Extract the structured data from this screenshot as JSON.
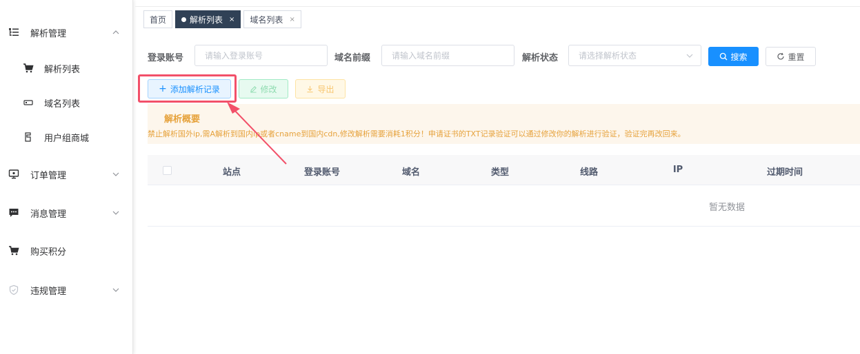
{
  "sidebar": {
    "items": [
      {
        "label": "解析管理",
        "icon": "list-tree-icon",
        "expanded": true
      },
      {
        "label": "解析列表",
        "icon": "cart-icon",
        "sub": true
      },
      {
        "label": "域名列表",
        "icon": "domain-card-icon",
        "sub": true
      },
      {
        "label": "用户组商城",
        "icon": "store-icon",
        "sub": true
      },
      {
        "label": "订单管理",
        "icon": "monitor-icon",
        "expanded": false
      },
      {
        "label": "消息管理",
        "icon": "message-icon",
        "expanded": false
      },
      {
        "label": "购买积分",
        "icon": "cart-icon"
      },
      {
        "label": "违规管理",
        "icon": "shield-icon",
        "expanded": false
      }
    ]
  },
  "tabs": [
    {
      "label": "首页",
      "active": false,
      "closable": false
    },
    {
      "label": "解析列表",
      "active": true,
      "closable": true
    },
    {
      "label": "域名列表",
      "active": false,
      "closable": true
    }
  ],
  "tab_close": "×",
  "search": {
    "account_label": "登录账号",
    "account_placeholder": "请输入登录账号",
    "prefix_label": "域名前缀",
    "prefix_placeholder": "请输入域名前缀",
    "status_label": "解析状态",
    "status_placeholder": "请选择解析状态",
    "search_btn": "搜索",
    "reset_btn": "重置"
  },
  "toolbar": {
    "add_btn": "添加解析记录",
    "edit_btn": "修改",
    "export_btn": "导出"
  },
  "notice": {
    "title": "解析概要",
    "text": "禁止解析国外ip,需A解析到国内ip或者cname到国内cdn,修改解析需要消耗1积分！申请证书的TXT记录验证可以通过修改你的解析进行验证，验证完再改回来。"
  },
  "table": {
    "columns": [
      "站点",
      "登录账号",
      "域名",
      "类型",
      "线路",
      "IP",
      "过期时间"
    ],
    "empty_text": "暂无数据"
  },
  "colors": {
    "primary": "#1890ff",
    "highlight": "#f25069",
    "tab_active": "#304156",
    "warning": "#e6a23c"
  }
}
